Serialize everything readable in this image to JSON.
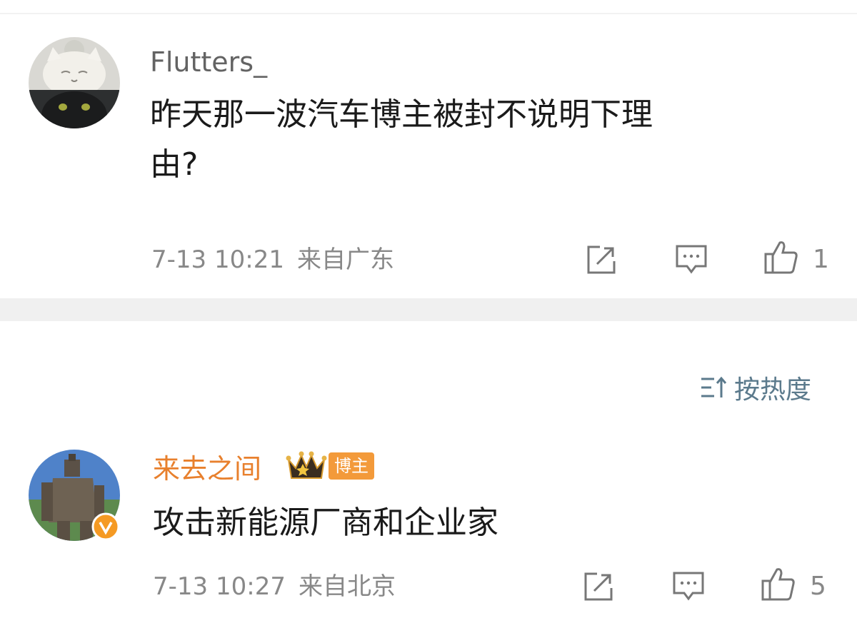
{
  "comments": [
    {
      "username": "Flutters_",
      "content_line1": "昨天那一波汽车博主被封不说明下理",
      "content_line2": "由?",
      "date": "7-13 10:21",
      "location": "来自广东",
      "likes": "1"
    },
    {
      "username": "来去之间",
      "badge_label": "博主",
      "content": "攻击新能源厂商和企业家",
      "date": "7-13 10:27",
      "location": "来自北京",
      "likes": "5"
    }
  ],
  "sort": {
    "label": "按热度",
    "icon": "sort-icon"
  },
  "icons": {
    "share": "share-icon",
    "reply": "comment-icon",
    "like": "thumbs-up-icon",
    "crown": "crown-icon",
    "verified": "verified-icon"
  },
  "colors": {
    "username_default": "#636363",
    "username_vip": "#e8802d",
    "meta": "#888888",
    "sort_text": "#5b7a8c",
    "badge_bg": "#f39a3a",
    "verified": "#f59a23"
  }
}
